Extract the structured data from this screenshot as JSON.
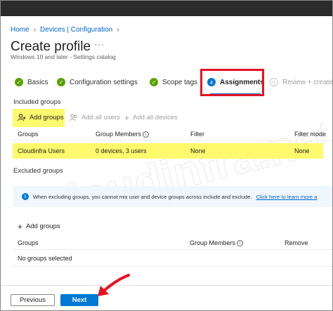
{
  "breadcrumb": {
    "home": "Home",
    "devices": "Devices | Configuration"
  },
  "header": {
    "title": "Create profile",
    "more_label": "···",
    "subtitle": "Windows 10 and later - Settings catalog"
  },
  "steps": [
    {
      "label": "Basics",
      "status": "complete"
    },
    {
      "label": "Configuration settings",
      "status": "complete"
    },
    {
      "label": "Scope tags",
      "status": "complete"
    },
    {
      "label": "Assignments",
      "status": "active",
      "number": "4"
    },
    {
      "label": "Review + create",
      "status": "inactive",
      "number": "5"
    }
  ],
  "included": {
    "heading": "Included groups",
    "toolbar": {
      "add_groups": "Add groups",
      "add_all_users": "Add all users",
      "add_all_devices": "Add all devices"
    },
    "columns": {
      "groups": "Groups",
      "group_members": "Group Members",
      "filter": "Filter",
      "filter_mode": "Filter mode"
    },
    "rows": [
      {
        "group": "Cloudinfra Users",
        "members": "0 devices, 3 users",
        "filter": "None",
        "filter_mode": "None"
      }
    ]
  },
  "excluded": {
    "heading": "Excluded groups",
    "banner_text": "When excluding groups, you cannot mix user and device groups across include and exclude.",
    "banner_link": "Click here to learn more a",
    "add_groups": "Add groups",
    "columns": {
      "groups": "Groups",
      "group_members": "Group Members",
      "remove": "Remove"
    },
    "empty_text": "No groups selected"
  },
  "footer": {
    "previous": "Previous",
    "next": "Next"
  },
  "watermark_text": "Cloudinfra.net",
  "colors": {
    "accent": "#0078d4",
    "highlight": "#fef96d",
    "annotation": "#e81123",
    "success": "#57a300"
  },
  "icons": [
    "chevron-right-icon",
    "check-circle-icon",
    "add-group-icon",
    "add-users-icon",
    "plus-icon",
    "info-icon"
  ]
}
